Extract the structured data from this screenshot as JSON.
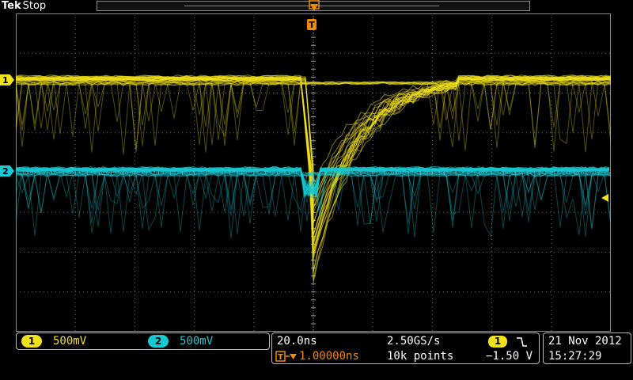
{
  "header": {
    "brand": "Tek",
    "status": "Stop"
  },
  "markers": {
    "ch1": "1",
    "ch2": "2",
    "trigger": "T"
  },
  "channels": [
    {
      "id": "1",
      "scale": "500mV",
      "color": "#f2e21a"
    },
    {
      "id": "2",
      "scale": "500mV",
      "color": "#17c9d4"
    }
  ],
  "timebase": {
    "horizontal_scale": "20.0ns",
    "sample_rate": "2.50GS/s",
    "record_length": "10k points",
    "trigger_delay": "1.00000ns",
    "trigger_source": "1",
    "trigger_level": "−1.50 V"
  },
  "date": "21 Nov 2012",
  "time": "15:27:29",
  "colors": {
    "ch1": "#f2e21a",
    "ch2": "#17c9d4",
    "trigger": "#f08a00",
    "grid": "#6a6a6a"
  }
}
